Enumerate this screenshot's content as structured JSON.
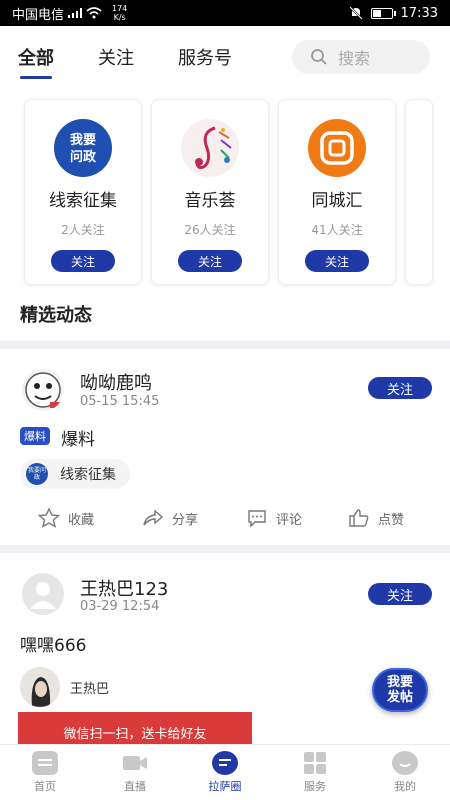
{
  "status_bar": {
    "carrier": "中国电信",
    "network_speed": "174",
    "network_unit": "K/s",
    "time": "17:33",
    "battery_level": 0.45
  },
  "tabs": [
    {
      "label": "全部",
      "active": true
    },
    {
      "label": "关注",
      "active": false
    },
    {
      "label": "服务号",
      "active": false
    }
  ],
  "search": {
    "placeholder": "搜索",
    "icon": "search-icon"
  },
  "channels": [
    {
      "name": "线索征集",
      "followers": "2人关注",
      "follow_label": "关注",
      "logo_text": "我要问政",
      "icon": "wenzheng-logo"
    },
    {
      "name": "音乐荟",
      "followers": "26人关注",
      "follow_label": "关注",
      "icon": "music-note-logo"
    },
    {
      "name": "同城汇",
      "followers": "41人关注",
      "follow_label": "关注",
      "icon": "tongcheng-logo"
    }
  ],
  "section_title": "精选动态",
  "posts": [
    {
      "author": "呦呦鹿鸣",
      "time": "05-15 15:45",
      "follow_label": "关注",
      "tag": "爆料",
      "text": "爆料",
      "channel_chip": "线索征集",
      "channel_chip_mini": "我要问政",
      "actions": [
        "收藏",
        "分享",
        "评论",
        "点赞"
      ]
    },
    {
      "author": "王热巴123",
      "time": "03-29 12:54",
      "follow_label": "关注",
      "text": "嘿嘿666",
      "mentioned_user": "王热巴",
      "banner_text": "微信扫一扫，送卡给好友"
    }
  ],
  "fab_label": "我要发帖",
  "bottom_nav": [
    {
      "label": "首页",
      "icon": "home-icon",
      "active": false
    },
    {
      "label": "直播",
      "icon": "video-icon",
      "active": false
    },
    {
      "label": "拉萨圈",
      "icon": "chat-circle-icon",
      "active": true
    },
    {
      "label": "服务",
      "icon": "grid-icon",
      "active": false
    },
    {
      "label": "我的",
      "icon": "profile-icon",
      "active": false
    }
  ],
  "colors": {
    "accent": "#1f3aa8",
    "divider": "#f1eef4",
    "banner": "#d93a3a"
  }
}
